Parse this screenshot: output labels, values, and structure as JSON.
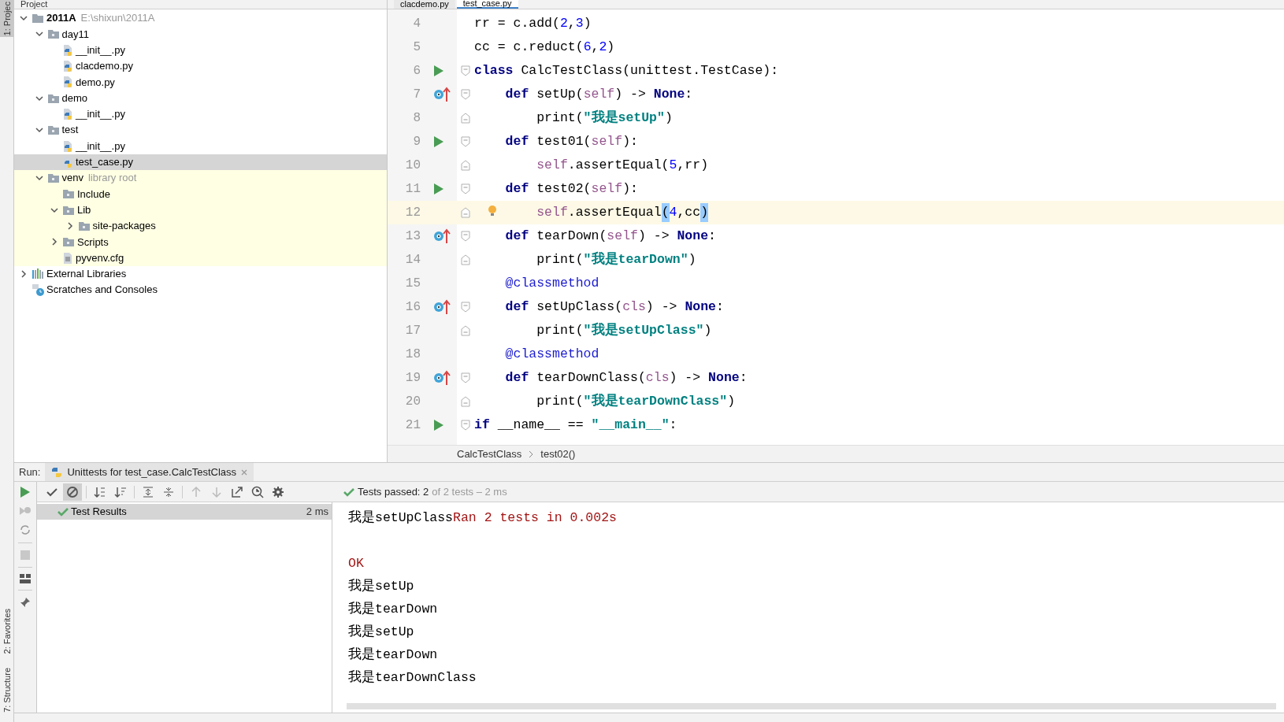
{
  "project_header": {
    "title": "Project"
  },
  "editor_tabs": [
    {
      "label": "clacdemo.py",
      "selected": false
    },
    {
      "label": "test_case.py",
      "selected": true
    }
  ],
  "project_tree": [
    {
      "label": "2011A",
      "hint": "E:\\shixun\\2011A",
      "kind": "root",
      "expanded": true,
      "selected": false,
      "children": [
        {
          "label": "day11",
          "kind": "folder",
          "expanded": true,
          "selected": false,
          "children": [
            {
              "label": "__init__.py",
              "kind": "python",
              "selected": false
            },
            {
              "label": "clacdemo.py",
              "kind": "python",
              "selected": false
            },
            {
              "label": "demo.py",
              "kind": "python",
              "selected": false
            }
          ]
        },
        {
          "label": "demo",
          "kind": "folder",
          "expanded": true,
          "selected": false,
          "children": [
            {
              "label": "__init__.py",
              "kind": "python",
              "selected": false
            }
          ]
        },
        {
          "label": "test",
          "kind": "folder",
          "expanded": true,
          "selected": false,
          "children": [
            {
              "label": "__init__.py",
              "kind": "python",
              "selected": false
            },
            {
              "label": "test_case.py",
              "kind": "python",
              "selected": true
            }
          ]
        },
        {
          "label": "venv",
          "hint": "library root",
          "kind": "folder",
          "library": true,
          "expanded": true,
          "selected": false,
          "children": [
            {
              "label": "Include",
              "kind": "folder",
              "selected": false
            },
            {
              "label": "Lib",
              "kind": "folder",
              "expanded": true,
              "selected": false,
              "children": [
                {
                  "label": "site-packages",
                  "kind": "folder",
                  "expanded": false,
                  "selected": false
                }
              ]
            },
            {
              "label": "Scripts",
              "kind": "folder",
              "expanded": false,
              "selected": false
            },
            {
              "label": "pyvenv.cfg",
              "kind": "config",
              "selected": false
            }
          ]
        }
      ]
    },
    {
      "label": "External Libraries",
      "kind": "libraries",
      "expanded": false,
      "selected": false
    },
    {
      "label": "Scratches and Consoles",
      "kind": "scratches",
      "selected": false
    }
  ],
  "code_lines": [
    {
      "number": "4",
      "run_marker": false,
      "override_marker": false,
      "intention_bulb": false,
      "fold_start": false,
      "fold_end": false,
      "current": false,
      "tokens": [
        {
          "text": "rr = c.add(",
          "kind": "plain"
        },
        {
          "text": "2",
          "kind": "number"
        },
        {
          "text": ",",
          "kind": "plain"
        },
        {
          "text": "3",
          "kind": "number"
        },
        {
          "text": ")",
          "kind": "plain"
        }
      ]
    },
    {
      "number": "5",
      "run_marker": false,
      "override_marker": false,
      "intention_bulb": false,
      "fold_start": false,
      "fold_end": false,
      "current": false,
      "tokens": [
        {
          "text": "cc = c.reduct(",
          "kind": "plain"
        },
        {
          "text": "6",
          "kind": "number"
        },
        {
          "text": ",",
          "kind": "plain"
        },
        {
          "text": "2",
          "kind": "number"
        },
        {
          "text": ")",
          "kind": "plain"
        }
      ]
    },
    {
      "number": "6",
      "run_marker": true,
      "override_marker": false,
      "intention_bulb": false,
      "fold_start": true,
      "fold_end": false,
      "current": false,
      "tokens": [
        {
          "text": "class",
          "kind": "keyword"
        },
        {
          "text": " CalcTestClass(unittest.TestCase):",
          "kind": "plain"
        }
      ],
      "children": [
        {
          "number": "7",
          "run_marker": false,
          "override_marker": true,
          "intention_bulb": false,
          "fold_start": true,
          "fold_end": false,
          "current": false,
          "tokens": [
            {
              "text": "def",
              "kind": "keyword"
            },
            {
              "text": " setUp(",
              "kind": "plain"
            },
            {
              "text": "self",
              "kind": "self"
            },
            {
              "text": ") -> ",
              "kind": "plain"
            },
            {
              "text": "None",
              "kind": "keyword"
            },
            {
              "text": ":",
              "kind": "plain"
            }
          ],
          "children": [
            {
              "number": "8",
              "run_marker": false,
              "override_marker": false,
              "intention_bulb": false,
              "fold_start": false,
              "fold_end": true,
              "current": false,
              "tokens": [
                {
                  "text": "print(",
                  "kind": "plain"
                },
                {
                  "text": "\"我是setUp\"",
                  "kind": "string"
                },
                {
                  "text": ")",
                  "kind": "plain"
                }
              ]
            }
          ]
        },
        {
          "number": "9",
          "run_marker": true,
          "override_marker": false,
          "intention_bulb": false,
          "fold_start": true,
          "fold_end": false,
          "current": false,
          "tokens": [
            {
              "text": "def",
              "kind": "keyword"
            },
            {
              "text": " test01(",
              "kind": "plain"
            },
            {
              "text": "self",
              "kind": "self"
            },
            {
              "text": "):",
              "kind": "plain"
            }
          ],
          "children": [
            {
              "number": "10",
              "run_marker": false,
              "override_marker": false,
              "intention_bulb": false,
              "fold_start": false,
              "fold_end": true,
              "current": false,
              "tokens": [
                {
                  "text": "self",
                  "kind": "self"
                },
                {
                  "text": ".assertEqual(",
                  "kind": "plain"
                },
                {
                  "text": "5",
                  "kind": "number"
                },
                {
                  "text": ",rr)",
                  "kind": "plain"
                }
              ]
            }
          ]
        },
        {
          "number": "11",
          "run_marker": true,
          "override_marker": false,
          "intention_bulb": false,
          "fold_start": true,
          "fold_end": false,
          "current": false,
          "tokens": [
            {
              "text": "def",
              "kind": "keyword"
            },
            {
              "text": " test02(",
              "kind": "plain"
            },
            {
              "text": "self",
              "kind": "self"
            },
            {
              "text": "):",
              "kind": "plain"
            }
          ],
          "children": [
            {
              "number": "12",
              "run_marker": false,
              "override_marker": false,
              "intention_bulb": true,
              "fold_start": false,
              "fold_end": true,
              "current": true,
              "tokens": [
                {
                  "text": "self",
                  "kind": "self"
                },
                {
                  "text": ".assertEqual",
                  "kind": "plain"
                },
                {
                  "text": "(",
                  "kind": "brace_match"
                },
                {
                  "text": "4",
                  "kind": "number"
                },
                {
                  "text": ",cc",
                  "kind": "plain"
                },
                {
                  "text": ")",
                  "kind": "brace_match"
                }
              ]
            }
          ]
        },
        {
          "number": "13",
          "run_marker": false,
          "override_marker": true,
          "intention_bulb": false,
          "fold_start": true,
          "fold_end": false,
          "current": false,
          "tokens": [
            {
              "text": "def",
              "kind": "keyword"
            },
            {
              "text": " tearDown(",
              "kind": "plain"
            },
            {
              "text": "self",
              "kind": "self"
            },
            {
              "text": ") -> ",
              "kind": "plain"
            },
            {
              "text": "None",
              "kind": "keyword"
            },
            {
              "text": ":",
              "kind": "plain"
            }
          ],
          "children": [
            {
              "number": "14",
              "run_marker": false,
              "override_marker": false,
              "intention_bulb": false,
              "fold_start": false,
              "fold_end": true,
              "current": false,
              "tokens": [
                {
                  "text": "print(",
                  "kind": "plain"
                },
                {
                  "text": "\"我是tearDown\"",
                  "kind": "string"
                },
                {
                  "text": ")",
                  "kind": "plain"
                }
              ]
            }
          ]
        },
        {
          "number": "15",
          "run_marker": false,
          "override_marker": false,
          "intention_bulb": false,
          "fold_start": false,
          "fold_end": false,
          "current": false,
          "tokens": [
            {
              "text": "@classmethod",
              "kind": "decorator"
            }
          ]
        },
        {
          "number": "16",
          "run_marker": false,
          "override_marker": true,
          "intention_bulb": false,
          "fold_start": true,
          "fold_end": false,
          "current": false,
          "tokens": [
            {
              "text": "def",
              "kind": "keyword"
            },
            {
              "text": " setUpClass(",
              "kind": "plain"
            },
            {
              "text": "cls",
              "kind": "self"
            },
            {
              "text": ") -> ",
              "kind": "plain"
            },
            {
              "text": "None",
              "kind": "keyword"
            },
            {
              "text": ":",
              "kind": "plain"
            }
          ],
          "children": [
            {
              "number": "17",
              "run_marker": false,
              "override_marker": false,
              "intention_bulb": false,
              "fold_start": false,
              "fold_end": true,
              "current": false,
              "tokens": [
                {
                  "text": "print(",
                  "kind": "plain"
                },
                {
                  "text": "\"我是setUpClass\"",
                  "kind": "string"
                },
                {
                  "text": ")",
                  "kind": "plain"
                }
              ]
            }
          ]
        },
        {
          "number": "18",
          "run_marker": false,
          "override_marker": false,
          "intention_bulb": false,
          "fold_start": false,
          "fold_end": false,
          "current": false,
          "tokens": [
            {
              "text": "@classmethod",
              "kind": "decorator"
            }
          ]
        },
        {
          "number": "19",
          "run_marker": false,
          "override_marker": true,
          "intention_bulb": false,
          "fold_start": true,
          "fold_end": false,
          "current": false,
          "tokens": [
            {
              "text": "def",
              "kind": "keyword"
            },
            {
              "text": " tearDownClass(",
              "kind": "plain"
            },
            {
              "text": "cls",
              "kind": "self"
            },
            {
              "text": ") -> ",
              "kind": "plain"
            },
            {
              "text": "None",
              "kind": "keyword"
            },
            {
              "text": ":",
              "kind": "plain"
            }
          ],
          "children": [
            {
              "number": "20",
              "run_marker": false,
              "override_marker": false,
              "intention_bulb": false,
              "fold_start": false,
              "fold_end": true,
              "current": false,
              "tokens": [
                {
                  "text": "print(",
                  "kind": "plain"
                },
                {
                  "text": "\"我是tearDownClass\"",
                  "kind": "string"
                },
                {
                  "text": ")",
                  "kind": "plain"
                }
              ]
            }
          ]
        }
      ]
    },
    {
      "number": "21",
      "run_marker": true,
      "override_marker": false,
      "intention_bulb": false,
      "fold_start": true,
      "fold_end": false,
      "current": false,
      "tokens": [
        {
          "text": "if",
          "kind": "keyword"
        },
        {
          "text": " __name__ == ",
          "kind": "plain"
        },
        {
          "text": "\"__main__\"",
          "kind": "string"
        },
        {
          "text": ":",
          "kind": "plain"
        }
      ]
    }
  ],
  "breadcrumbs": [
    "CalcTestClass",
    "test02()"
  ],
  "run_panel": {
    "label": "Run:",
    "tab": "Unittests for test_case.CalcTestClass",
    "show_passed_pressed": false,
    "show_ignored_pressed": true,
    "status": {
      "passed": "Tests passed: 2",
      "detail": "of 2 tests – 2 ms"
    },
    "tests": [
      {
        "label": "Test Results",
        "time": "2 ms",
        "passed": true,
        "selected": true
      }
    ],
    "output": [
      {
        "kind": "text",
        "parts": [
          {
            "text": "我是setUpClass",
            "kind": "stdout"
          },
          {
            "text": "Ran 2 tests in 0.002s",
            "kind": "stderr"
          }
        ]
      },
      {
        "kind": "blank"
      },
      {
        "kind": "text",
        "parts": [
          {
            "text": "OK",
            "kind": "stderr"
          }
        ]
      },
      {
        "kind": "text",
        "parts": [
          {
            "text": "我是setUp",
            "kind": "stdout"
          }
        ]
      },
      {
        "kind": "text",
        "parts": [
          {
            "text": "我是tearDown",
            "kind": "stdout"
          }
        ]
      },
      {
        "kind": "text",
        "parts": [
          {
            "text": "我是setUp",
            "kind": "stdout"
          }
        ]
      },
      {
        "kind": "text",
        "parts": [
          {
            "text": "我是tearDown",
            "kind": "stdout"
          }
        ]
      },
      {
        "kind": "text",
        "parts": [
          {
            "text": "我是tearDownClass",
            "kind": "stdout"
          }
        ]
      }
    ]
  },
  "side_tool_windows_top": [
    {
      "label": "1: Projec",
      "selected": true
    }
  ],
  "side_tool_windows_bottom": [
    {
      "label": "2: Favorites",
      "selected": false
    },
    {
      "label": "7: Structure",
      "selected": false
    }
  ]
}
